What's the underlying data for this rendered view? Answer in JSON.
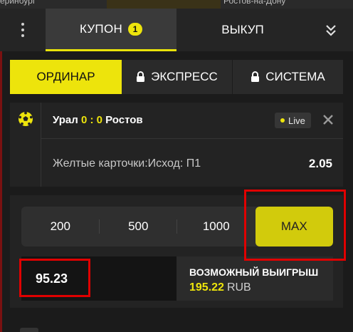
{
  "background": {
    "left_text": "еринбург",
    "right_text": "Ростов-на-Дону"
  },
  "header": {
    "coupon_tab": "КУПОН",
    "coupon_count": "1",
    "buyout_tab": "ВЫКУП"
  },
  "bet_types": {
    "single": "ОРДИНАР",
    "express": "ЭКСПРЕСС",
    "system": "СИСТЕМА"
  },
  "bet": {
    "team_home": "Урал",
    "score": "0 : 0",
    "team_away": "Ростов",
    "live_label": "Live",
    "market": "Желтые карточки:Исход: П1",
    "odds": "2.05"
  },
  "stake": {
    "quick_amounts": [
      "200",
      "500",
      "1000",
      "MAX"
    ],
    "amount": "95.23",
    "possible_win_label": "ВОЗМОЖНЫЙ ВЫИГРЫШ",
    "possible_win_value": "195.22",
    "currency": "RUB"
  },
  "colors": {
    "accent": "#ede40c",
    "highlight": "#e00000",
    "panel": "#232323"
  }
}
